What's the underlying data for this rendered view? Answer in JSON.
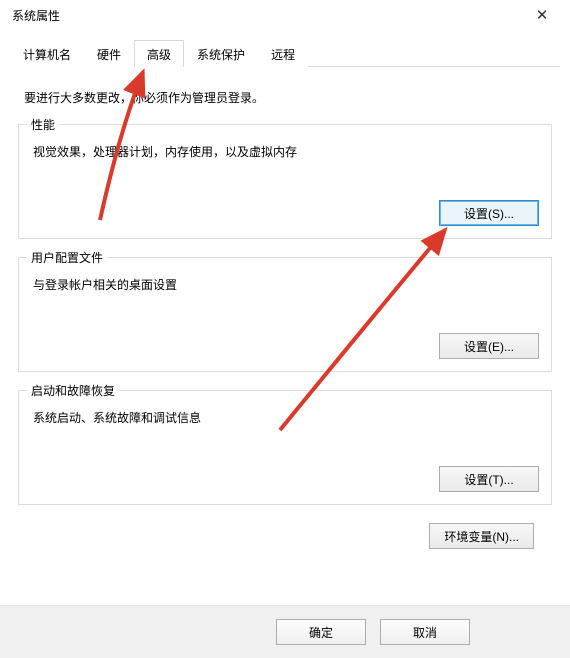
{
  "window": {
    "title": "系统属性",
    "close_icon": "✕"
  },
  "tabs": {
    "computer_name": "计算机名",
    "hardware": "硬件",
    "advanced": "高级",
    "system_protection": "系统保护",
    "remote": "远程"
  },
  "intro": "要进行大多数更改，你必须作为管理员登录。",
  "group_performance": {
    "legend": "性能",
    "desc": "视觉效果，处理器计划，内存使用，以及虚拟内存",
    "settings_btn": "设置(S)..."
  },
  "group_userprofile": {
    "legend": "用户配置文件",
    "desc": "与登录帐户相关的桌面设置",
    "settings_btn": "设置(E)..."
  },
  "group_startup": {
    "legend": "启动和故障恢复",
    "desc": "系统启动、系统故障和调试信息",
    "settings_btn": "设置(T)..."
  },
  "env_btn": "环境变量(N)...",
  "bottom": {
    "ok": "确定",
    "cancel": "取消"
  }
}
